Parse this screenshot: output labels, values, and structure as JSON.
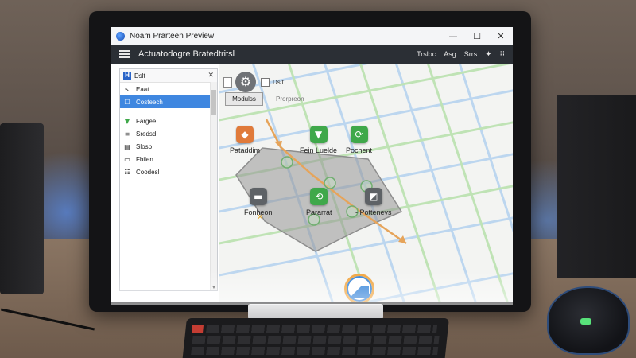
{
  "window": {
    "title": "Noam Prarteen Preview",
    "controls": {
      "minimize": "—",
      "maximize": "☐",
      "close": "✕"
    }
  },
  "toolbar": {
    "title": "Actuatodogre Bratedtritsl",
    "links": [
      "Trsloc",
      "Asg",
      "Srrs"
    ],
    "icons": [
      "pin-icon",
      "grid-icon"
    ],
    "pin_glyph": "✦",
    "grid_glyph": "⁞⁞"
  },
  "sidebar": {
    "tab_label": "Dslt",
    "tab_icon_glyph": "H",
    "close_glyph": "✕",
    "items_top": [
      {
        "label": "Eaat",
        "glyph": "↖"
      },
      {
        "label": "Costeech",
        "glyph": "☐",
        "selected": true
      }
    ],
    "items_bottom": [
      {
        "label": "Fargee",
        "glyph": "▼"
      },
      {
        "label": "Sredsd",
        "glyph": "≡"
      },
      {
        "label": "Slosb",
        "glyph": "▤"
      },
      {
        "label": "Fbilen",
        "glyph": "▭"
      },
      {
        "label": "Coodesl",
        "glyph": "☷"
      }
    ]
  },
  "map": {
    "toolbar_label": "Dsit",
    "modules_button": "Modulss",
    "progress_label": "Prorpreon",
    "nodes": [
      {
        "label": "Pataddim",
        "color": "#e07a3a",
        "glyph": "◆"
      },
      {
        "label": "Fein Luelde",
        "color": "#3fa84a",
        "glyph": "▼"
      },
      {
        "label": "Pochent",
        "color": "#3fa84a",
        "glyph": "⟳"
      },
      {
        "label": "Fonheon",
        "color": "#5e6266",
        "glyph": "▬"
      },
      {
        "label": "Pararrat",
        "color": "#3fa84a",
        "glyph": "⟲"
      },
      {
        "label": "- Potteneys",
        "color": "#5e6266",
        "glyph": "◩"
      }
    ]
  },
  "colors": {
    "toolbar_bg": "#2b2f35",
    "selection": "#3f87e0",
    "route_orange": "#e6a45a",
    "road_green": "#bfe3b5",
    "road_blue": "#bcd6ef"
  }
}
